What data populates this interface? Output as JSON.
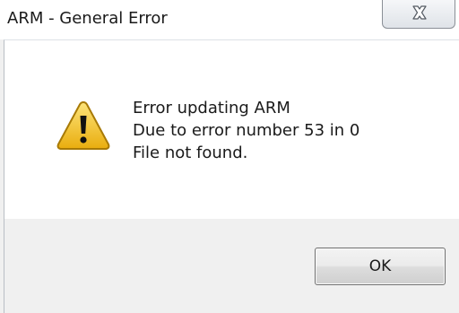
{
  "window": {
    "title": "ARM - General Error",
    "close_icon": "close-icon"
  },
  "dialog": {
    "icon": "warning-icon",
    "message_lines": [
      "Error updating ARM",
      "Due to error number 53 in 0",
      "File not found."
    ],
    "ok_label": "OK"
  },
  "colors": {
    "warning_fill": "#f3c623",
    "content_background": "#ffffff",
    "button_area_background": "#f0f0f0"
  }
}
